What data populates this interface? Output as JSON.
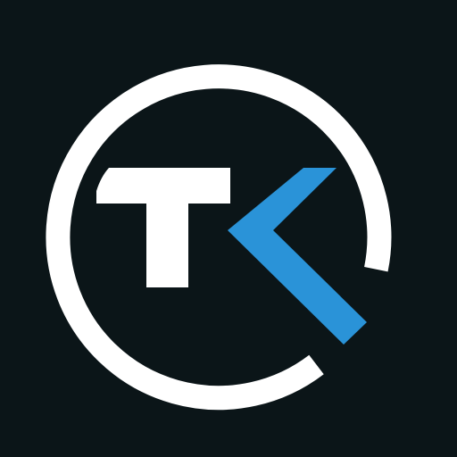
{
  "logo": {
    "name": "TK",
    "icon": "tk-monogram-logo-icon",
    "lettering": "TK"
  },
  "colors": {
    "background": "#0b1518",
    "ring": "#ffffff",
    "letter_t": "#ffffff",
    "letter_k": "#2a93d8"
  }
}
